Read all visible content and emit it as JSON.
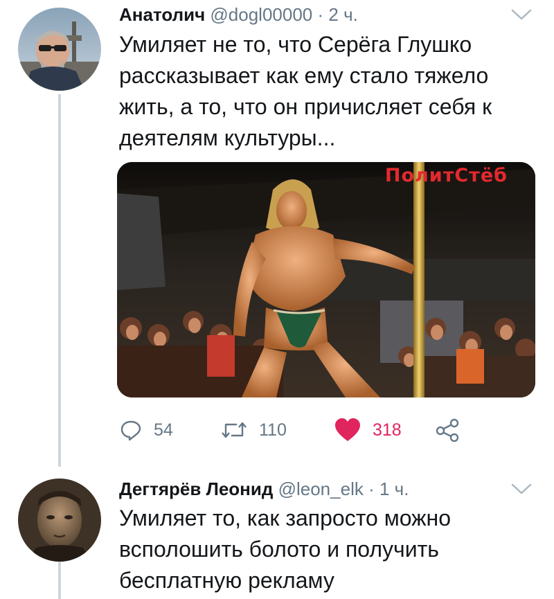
{
  "tweets": [
    {
      "author": {
        "name": "Анатолич",
        "handle": "@dogl00000",
        "avatar_icon": "avatar-photo-man-sunglasses"
      },
      "separator": "·",
      "time": "2 ч.",
      "text": "Умиляет не то, что Серёга Глушко рассказывает как ему стало тяжело жить, а то, что он причисляет себя к деятелям культуры...",
      "media": {
        "watermark": "ПолитСтёб",
        "description_icon": "photo-stage-performer"
      },
      "actions": {
        "reply": {
          "icon": "reply-icon",
          "count": "54"
        },
        "retweet": {
          "icon": "retweet-icon",
          "count": "110"
        },
        "like": {
          "icon": "heart-icon",
          "count": "318",
          "active": true
        },
        "share": {
          "icon": "share-icon"
        }
      }
    },
    {
      "author": {
        "name": "Дегтярёв Леонид",
        "handle": "@leon_elk",
        "avatar_icon": "avatar-photo-man-sepia"
      },
      "separator": "·",
      "time": "1 ч.",
      "text": "Умиляет то, как запросто можно всполошить болото и получить бесплатную рекламу"
    }
  ],
  "colors": {
    "text": "#14171a",
    "secondary": "#657786",
    "like": "#e0245e",
    "thread_line": "#ccd6dd",
    "watermark": "#e4292e"
  }
}
